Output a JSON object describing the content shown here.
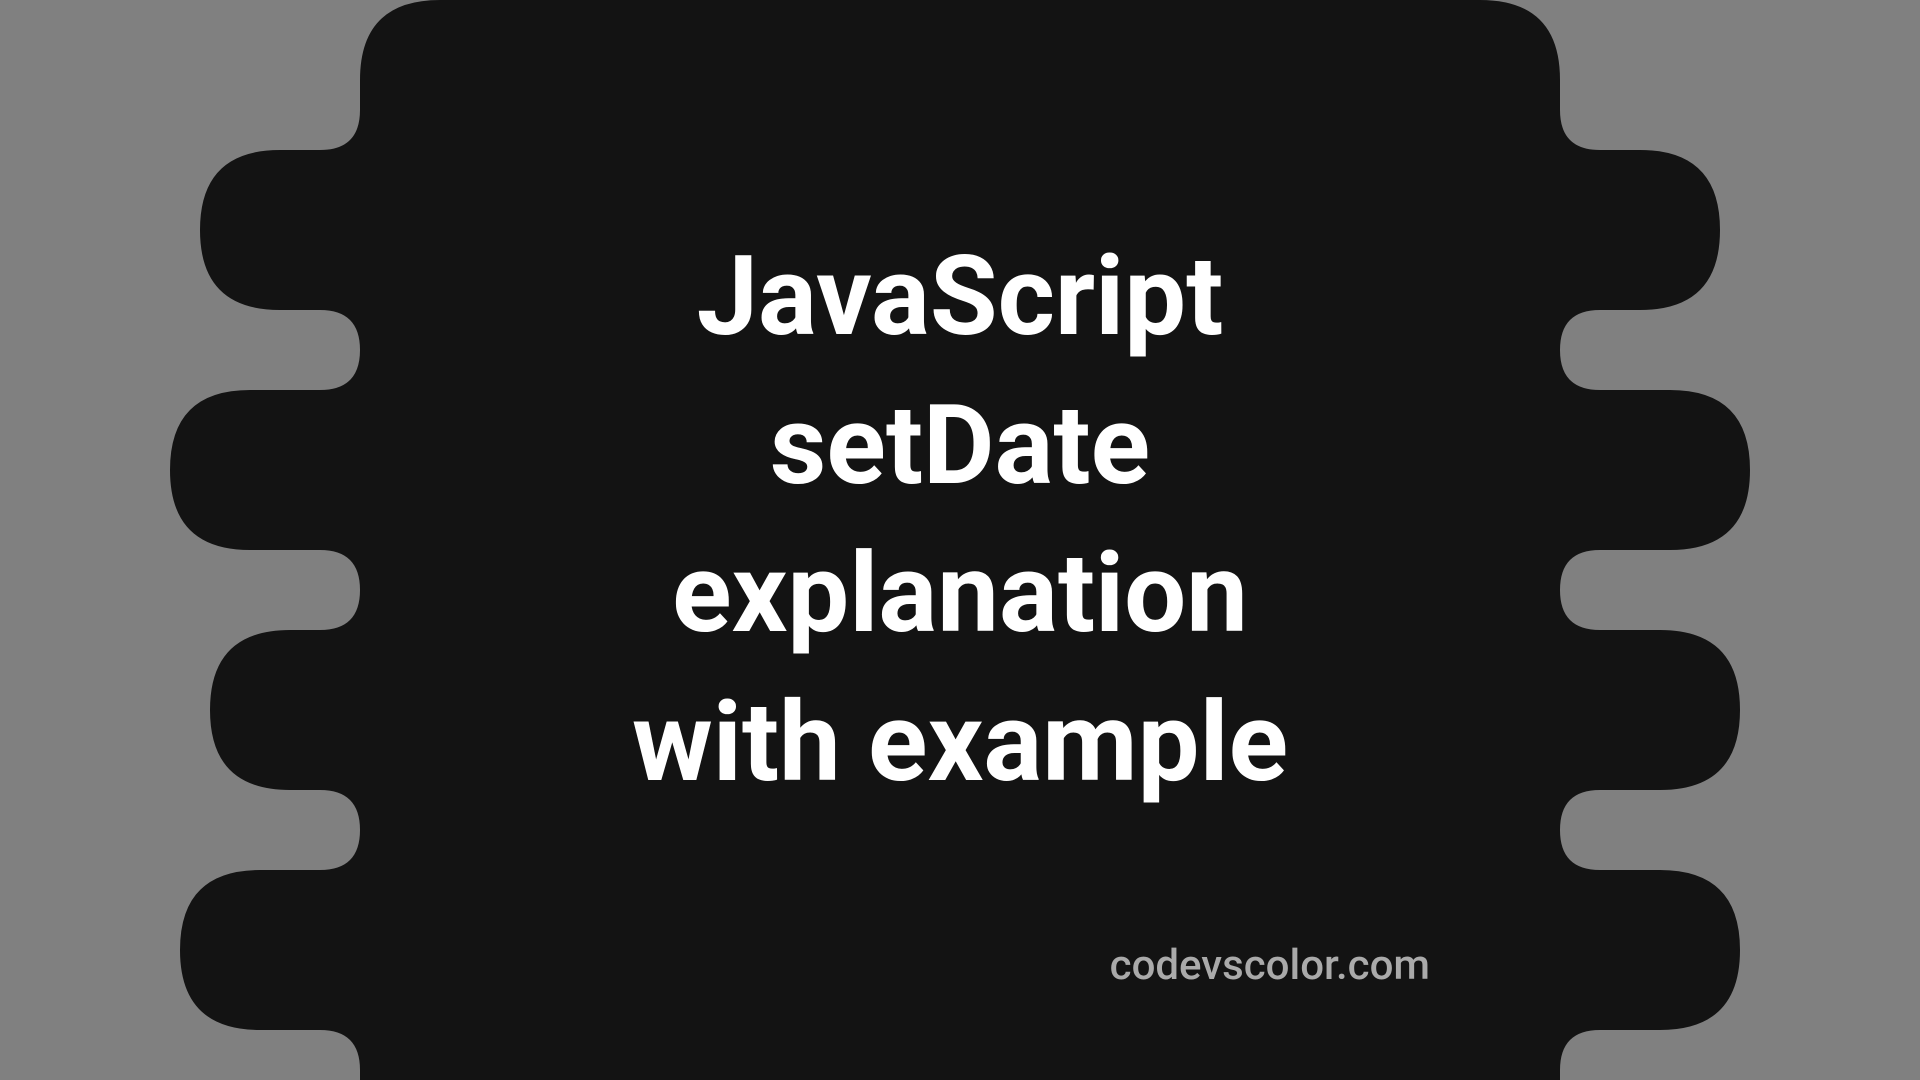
{
  "title_line1": "JavaScript",
  "title_line2": "setDate",
  "title_line3": "explanation",
  "title_line4": "with example",
  "website": "codevscolor.com"
}
